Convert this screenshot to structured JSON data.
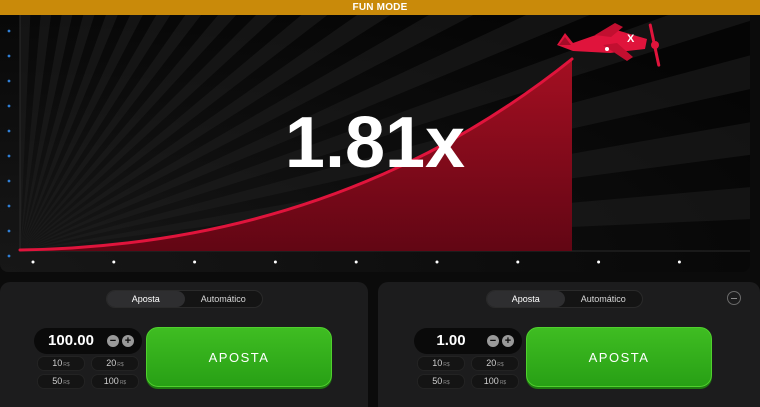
{
  "banner": {
    "label": "FUN MODE"
  },
  "game": {
    "multiplier": "1.81x"
  },
  "bet_panels": [
    {
      "tabs": [
        "Aposta",
        "Automático"
      ],
      "active_tab": "Aposta",
      "stake": "100.00",
      "minus": "−",
      "plus": "+",
      "quick_amounts": [
        {
          "value": "10",
          "currency": "R$"
        },
        {
          "value": "20",
          "currency": "R$"
        },
        {
          "value": "50",
          "currency": "R$"
        },
        {
          "value": "100",
          "currency": "R$"
        }
      ],
      "bet_label": "APOSTA"
    },
    {
      "tabs": [
        "Aposta",
        "Automático"
      ],
      "active_tab": "Aposta",
      "stake": "1.00",
      "minus": "−",
      "plus": "+",
      "quick_amounts": [
        {
          "value": "10",
          "currency": "R$"
        },
        {
          "value": "20",
          "currency": "R$"
        },
        {
          "value": "50",
          "currency": "R$"
        },
        {
          "value": "100",
          "currency": "R$"
        }
      ],
      "bet_label": "APOSTA"
    }
  ],
  "colors": {
    "banner": "#c98a0a",
    "curve": "#e0143c",
    "bet_button": "#2fae1b",
    "axis_dot_left": "#2f7fd6",
    "axis_dot_bottom": "#ffffff"
  },
  "icons": {
    "plane": "plane-icon",
    "remove": "minus-circle-icon"
  }
}
